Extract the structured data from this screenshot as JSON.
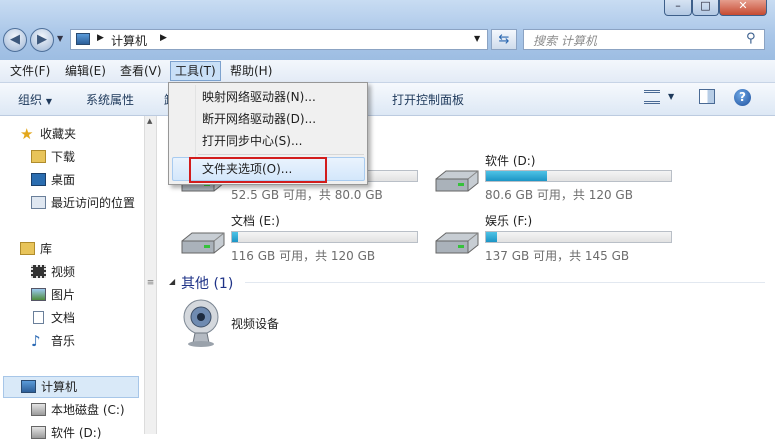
{
  "window": {
    "minimize": "–",
    "maximize": "□",
    "close": "✕"
  },
  "address": {
    "crumb": "计算机"
  },
  "search": {
    "placeholder": "搜索 计算机"
  },
  "menubar": {
    "file": "文件(F)",
    "edit": "编辑(E)",
    "view": "查看(V)",
    "tools": "工具(T)",
    "help": "帮助(H)"
  },
  "toolbar": {
    "organize": "组织",
    "properties": "系统属性",
    "partial": "卸",
    "control_panel": "打开控制面板"
  },
  "tools_menu": {
    "items": [
      "映射网络驱动器(N)...",
      "断开网络驱动器(D)...",
      "打开同步中心(S)..."
    ],
    "folder_options": "文件夹选项(O)..."
  },
  "nav": {
    "favorites": "收藏夹",
    "downloads": "下载",
    "desktop": "桌面",
    "recent": "最近访问的位置",
    "libraries": "库",
    "videos": "视频",
    "pictures": "图片",
    "documents": "文档",
    "music": "音乐",
    "computer": "计算机",
    "local_disk": "本地磁盘 (C:)",
    "software_partial": "软件 (D:)"
  },
  "drives": [
    {
      "name": "",
      "free_text": "52.5 GB 可用，共 80.0 GB",
      "used_fraction": 0.34
    },
    {
      "name": "软件 (D:)",
      "free_text": "80.6 GB 可用，共 120 GB",
      "used_fraction": 0.33
    },
    {
      "name": "文档 (E:)",
      "free_text": "116 GB 可用，共 120 GB",
      "used_fraction": 0.03
    },
    {
      "name": "娱乐 (F:)",
      "free_text": "137 GB 可用，共 145 GB",
      "used_fraction": 0.06
    }
  ],
  "other": {
    "header": "其他 (1)",
    "device": "视频设备"
  },
  "colors": {
    "highlight_box": "#d21c1c",
    "menu_bg": "#f0f0f0",
    "bar_fill": "#26a0da",
    "header_blue": "#1e3287"
  }
}
